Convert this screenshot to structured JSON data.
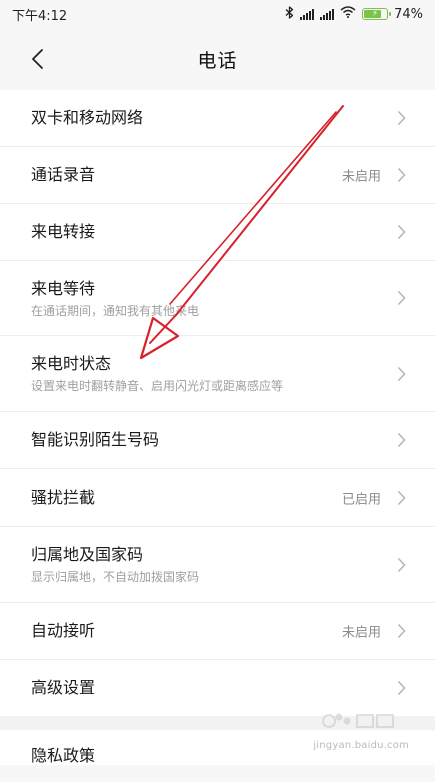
{
  "status_bar": {
    "time": "下午4:12",
    "battery": "74%",
    "icons": [
      "bluetooth-icon",
      "signal-icon",
      "signal-icon",
      "wifi-icon",
      "battery-icon"
    ]
  },
  "header": {
    "title": "电话",
    "back_icon": "chevron-left-icon"
  },
  "settings": [
    {
      "title": "双卡和移动网络",
      "subtitle": "",
      "status": ""
    },
    {
      "title": "通话录音",
      "subtitle": "",
      "status": "未启用"
    },
    {
      "title": "来电转接",
      "subtitle": "",
      "status": ""
    },
    {
      "title": "来电等待",
      "subtitle": "在通话期间，通知我有其他来电",
      "status": ""
    },
    {
      "title": "来电时状态",
      "subtitle": "设置来电时翻转静音、启用闪光灯或距离感应等",
      "status": ""
    },
    {
      "title": "智能识别陌生号码",
      "subtitle": "",
      "status": ""
    },
    {
      "title": "骚扰拦截",
      "subtitle": "",
      "status": "已启用"
    },
    {
      "title": "归属地及国家码",
      "subtitle": "显示归属地，不自动加拨国家码",
      "status": ""
    },
    {
      "title": "自动接听",
      "subtitle": "",
      "status": "未启用"
    },
    {
      "title": "高级设置",
      "subtitle": "",
      "status": ""
    }
  ],
  "settings_2": [
    {
      "title": "隐私政策",
      "subtitle": "",
      "status": ""
    }
  ],
  "watermark": {
    "domain": "jingyan.baidu.com"
  },
  "colors": {
    "annotation_arrow": "#d9212a",
    "battery": "#7bc44a",
    "chevron": "#b5b5b5"
  }
}
